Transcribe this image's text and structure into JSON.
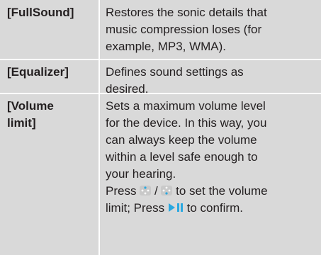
{
  "rows": [
    {
      "term": "[FullSound]",
      "description_lines": [
        "Restores the sonic details that",
        "music compression loses (for",
        "example, MP3, WMA)."
      ]
    },
    {
      "term": "[Equalizer]",
      "description_lines": [
        "Defines sound settings as",
        "desired."
      ]
    },
    {
      "term_lines": [
        "[Volume",
        "limit]"
      ],
      "description_lines": [
        "Sets a maximum volume level",
        "for the device. In this way, you",
        "can always keep the volume",
        "within a level safe enough to",
        "your hearing."
      ],
      "instruction": {
        "press_1": "Press",
        "separator": "/",
        "action_1": "to set the volume",
        "line2_prefix": "limit; Press",
        "action_2": "to confirm.",
        "icons": [
          "volume-up-key-icon",
          "volume-down-key-icon",
          "play-pause-key-icon"
        ]
      }
    }
  ],
  "colors": {
    "cell_background": "#d9d9d9",
    "divider": "#ffffff",
    "text": "#231f20",
    "key_icon_blue": "#29a8e0"
  }
}
